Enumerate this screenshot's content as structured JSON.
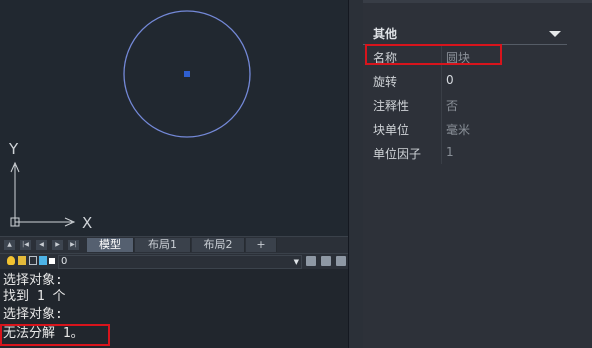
{
  "axes": {
    "x": "X",
    "y": "Y"
  },
  "tabs": {
    "nav": [
      "▲",
      "|◀",
      "◀",
      "▶",
      "▶|"
    ],
    "model": "模型",
    "layout1": "布局1",
    "layout2": "布局2",
    "add": "+"
  },
  "layer": {
    "name": "0",
    "dropdown_arrow": "▼"
  },
  "command": {
    "lines": [
      "选择对象:",
      "找到 1 个",
      "选择对象:",
      "无法分解 1。"
    ]
  },
  "properties": {
    "section_title": "其他",
    "rows": [
      {
        "name": "名称",
        "value": "圆块"
      },
      {
        "name": "旋转",
        "value": "0"
      },
      {
        "name": "注释性",
        "value": "否"
      },
      {
        "name": "块单位",
        "value": "毫米"
      },
      {
        "name": "单位因子",
        "value": "1"
      }
    ]
  },
  "colors": {
    "circle": "#7489d8",
    "center_marker": "#2f5fd0",
    "highlight": "#d8141c",
    "active_tab": "#556070"
  }
}
